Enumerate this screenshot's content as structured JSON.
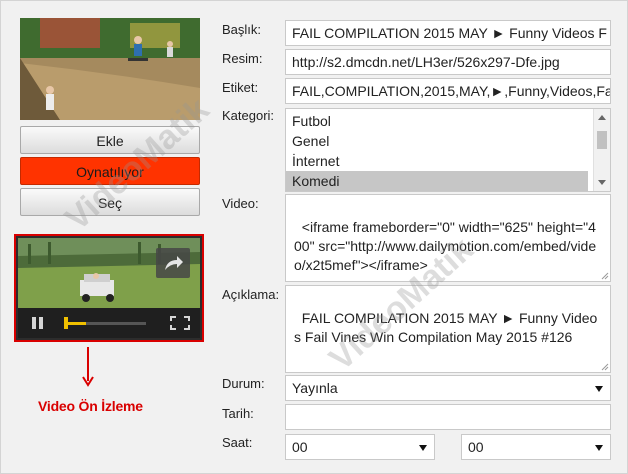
{
  "left_panel": {
    "buttons": {
      "add": "Ekle",
      "playing": "Oynatılıyor",
      "select": "Seç"
    },
    "thumbnail": {
      "alt": "skatepark-ramp"
    },
    "preview": {
      "progress": 0.25,
      "caption": "Video Ön İzleme",
      "icons": [
        "pause-icon",
        "share-icon",
        "fullscreen-icon"
      ],
      "accent_color": "#d90000"
    }
  },
  "form": {
    "title": {
      "label": "Başlık:",
      "value": "FAIL COMPILATION 2015 MAY ► Funny Videos F"
    },
    "image": {
      "label": "Resim:",
      "value": "http://s2.dmcdn.net/LH3er/526x297-Dfe.jpg"
    },
    "tags": {
      "label": "Etiket:",
      "value": "FAIL,COMPILATION,2015,MAY,►,Funny,Videos,Fa"
    },
    "category": {
      "label": "Kategori:",
      "options": [
        "Futbol",
        "Genel",
        "İnternet",
        "Komedi"
      ],
      "selected_index": 3
    },
    "video": {
      "label": "Video:",
      "value": "<iframe frameborder=\"0\" width=\"625\" height=\"400\" src=\"http://www.dailymotion.com/embed/video/x2t5mef\"></iframe>"
    },
    "description": {
      "label": "Açıklama:",
      "value": "FAIL COMPILATION 2015 MAY ► Funny Videos Fail Vines Win Compilation May 2015 #126"
    },
    "status": {
      "label": "Durum:",
      "value": "Yayınla"
    },
    "date": {
      "label": "Tarih:",
      "value": ""
    },
    "time": {
      "label": "Saat:",
      "hour": "00",
      "minute": "00"
    }
  },
  "watermark": "VideoMatik",
  "colors": {
    "playing_button": "#ff3300",
    "preview_border": "#d90000",
    "progress": "#f0c000",
    "selected_option": "#c6c6c6"
  }
}
